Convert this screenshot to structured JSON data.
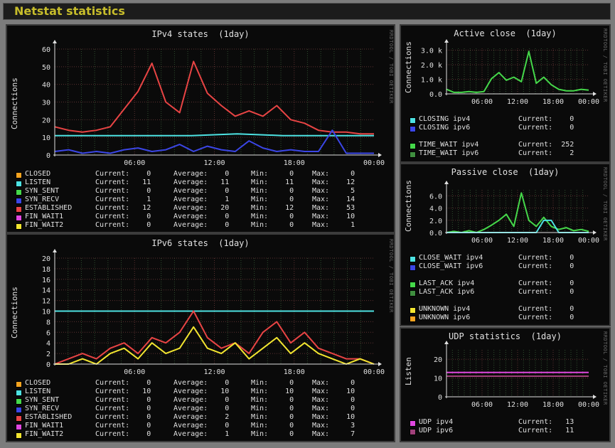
{
  "header": {
    "title": "Netstat statistics"
  },
  "rrdtool_label": "RRDTOOL / TOBI OETIKER",
  "stat_labels": {
    "current": "Current:",
    "average": "Average:",
    "min": "Min:",
    "max": "Max:"
  },
  "panels": {
    "ipv4": {
      "title": "IPv4 states  (1day)",
      "ylabel": "Connections",
      "yticks": [
        "0",
        "10",
        "20",
        "30",
        "40",
        "50",
        "60"
      ],
      "xticks": [
        "06:00",
        "12:00",
        "18:00",
        "00:00"
      ],
      "legend": [
        {
          "name": "CLOSED",
          "color": "#f4a31f",
          "cur": "0",
          "avg": "0",
          "min": "0",
          "max": "0"
        },
        {
          "name": "LISTEN",
          "color": "#4de2e2",
          "cur": "11",
          "avg": "11",
          "min": "11",
          "max": "12"
        },
        {
          "name": "SYN_SENT",
          "color": "#45d84a",
          "cur": "0",
          "avg": "0",
          "min": "0",
          "max": "5"
        },
        {
          "name": "SYN_RECV",
          "color": "#3b46e6",
          "cur": "1",
          "avg": "1",
          "min": "0",
          "max": "14"
        },
        {
          "name": "ESTABLISHED",
          "color": "#e84444",
          "cur": "12",
          "avg": "20",
          "min": "12",
          "max": "53"
        },
        {
          "name": "FIN_WAIT1",
          "color": "#e047e0",
          "cur": "0",
          "avg": "0",
          "min": "0",
          "max": "10"
        },
        {
          "name": "FIN_WAIT2",
          "color": "#f2e530",
          "cur": "0",
          "avg": "0",
          "min": "0",
          "max": "1"
        }
      ]
    },
    "ipv6": {
      "title": "IPv6 states  (1day)",
      "ylabel": "Connections",
      "yticks": [
        "0",
        "2",
        "4",
        "6",
        "8",
        "10",
        "12",
        "14",
        "16",
        "18",
        "20"
      ],
      "xticks": [
        "06:00",
        "12:00",
        "18:00",
        "00:00"
      ],
      "legend": [
        {
          "name": "CLOSED",
          "color": "#f4a31f",
          "cur": "0",
          "avg": "0",
          "min": "0",
          "max": "0"
        },
        {
          "name": "LISTEN",
          "color": "#4de2e2",
          "cur": "10",
          "avg": "10",
          "min": "10",
          "max": "10"
        },
        {
          "name": "SYN_SENT",
          "color": "#45d84a",
          "cur": "0",
          "avg": "0",
          "min": "0",
          "max": "0"
        },
        {
          "name": "SYN_RECV",
          "color": "#3b46e6",
          "cur": "0",
          "avg": "0",
          "min": "0",
          "max": "0"
        },
        {
          "name": "ESTABLISHED",
          "color": "#e84444",
          "cur": "0",
          "avg": "2",
          "min": "0",
          "max": "10"
        },
        {
          "name": "FIN_WAIT1",
          "color": "#e047e0",
          "cur": "0",
          "avg": "0",
          "min": "0",
          "max": "3"
        },
        {
          "name": "FIN_WAIT2",
          "color": "#f2e530",
          "cur": "0",
          "avg": "1",
          "min": "0",
          "max": "7"
        }
      ]
    },
    "active": {
      "title": "Active close  (1day)",
      "ylabel": "Connections",
      "yticks": [
        "0.0",
        "1.0 k",
        "2.0 k",
        "3.0 k"
      ],
      "xticks": [
        "06:00",
        "12:00",
        "18:00",
        "00:00"
      ],
      "legend": [
        {
          "name": "CLOSING ipv4",
          "color": "#4de2e2",
          "cur": "0"
        },
        {
          "name": "CLOSING ipv6",
          "color": "#3b46e6",
          "cur": "0"
        },
        {
          "name": "TIME_WAIT ipv4",
          "color": "#45d84a",
          "cur": "252"
        },
        {
          "name": "TIME_WAIT ipv6",
          "color": "#3f8e3f",
          "cur": "2"
        }
      ]
    },
    "passive": {
      "title": "Passive close  (1day)",
      "ylabel": "Connections",
      "yticks": [
        "0.0",
        "2.0",
        "4.0",
        "6.0"
      ],
      "xticks": [
        "06:00",
        "12:00",
        "18:00",
        "00:00"
      ],
      "legend": [
        {
          "name": "CLOSE_WAIT ipv4",
          "color": "#4de2e2",
          "cur": "0"
        },
        {
          "name": "CLOSE_WAIT ipv6",
          "color": "#3b46e6",
          "cur": "0"
        },
        {
          "name": "LAST_ACK ipv4",
          "color": "#45d84a",
          "cur": "0"
        },
        {
          "name": "LAST_ACK ipv6",
          "color": "#3f8e3f",
          "cur": "0"
        },
        {
          "name": "UNKNOWN ipv4",
          "color": "#f2e530",
          "cur": "0"
        },
        {
          "name": "UNKNOWN ipv6",
          "color": "#f4a31f",
          "cur": "0"
        }
      ]
    },
    "udp": {
      "title": "UDP statistics  (1day)",
      "ylabel": "Listen",
      "yticks": [
        "0",
        "10",
        "20"
      ],
      "xticks": [
        "06:00",
        "12:00",
        "18:00",
        "00:00"
      ],
      "legend": [
        {
          "name": "UDP ipv4",
          "color": "#e047e0",
          "cur": "13"
        },
        {
          "name": "UDP ipv6",
          "color": "#a0407a",
          "cur": "11"
        }
      ]
    }
  },
  "chart_data": [
    {
      "type": "line",
      "title": "IPv4 states  (1day)",
      "ylabel": "Connections",
      "ylim": [
        0,
        60
      ],
      "x": [
        "06:00",
        "12:00",
        "18:00",
        "00:00"
      ],
      "series": [
        {
          "name": "LISTEN",
          "values": [
            11,
            11,
            11,
            11,
            12,
            11,
            11,
            11
          ]
        },
        {
          "name": "ESTABLISHED",
          "values": [
            16,
            14,
            13,
            14,
            16,
            26,
            36,
            52,
            30,
            24,
            53,
            35,
            28,
            22,
            25,
            22,
            28,
            20,
            18,
            14,
            13,
            13,
            12,
            12
          ]
        },
        {
          "name": "SYN_RECV",
          "values": [
            2,
            3,
            1,
            2,
            1,
            3,
            4,
            2,
            3,
            6,
            2,
            5,
            3,
            2,
            8,
            4,
            2,
            3,
            2,
            2,
            14,
            1,
            1,
            1
          ]
        }
      ]
    },
    {
      "type": "line",
      "title": "IPv6 states  (1day)",
      "ylabel": "Connections",
      "ylim": [
        0,
        20
      ],
      "x": [
        "06:00",
        "12:00",
        "18:00",
        "00:00"
      ],
      "series": [
        {
          "name": "LISTEN",
          "values": [
            10,
            10,
            10,
            10,
            10,
            10,
            10,
            10
          ]
        },
        {
          "name": "ESTABLISHED",
          "values": [
            0,
            1,
            2,
            1,
            3,
            4,
            2,
            5,
            4,
            6,
            10,
            5,
            3,
            4,
            2,
            6,
            8,
            4,
            6,
            3,
            2,
            1,
            1,
            0
          ]
        },
        {
          "name": "FIN_WAIT2",
          "values": [
            0,
            0,
            1,
            0,
            2,
            3,
            1,
            4,
            2,
            3,
            7,
            3,
            2,
            4,
            1,
            3,
            5,
            2,
            4,
            2,
            1,
            0,
            1,
            0
          ]
        }
      ]
    },
    {
      "type": "line",
      "title": "Active close  (1day)",
      "ylabel": "Connections",
      "ylim": [
        0,
        3000
      ],
      "x": [
        "06:00",
        "12:00",
        "18:00",
        "00:00"
      ],
      "series": [
        {
          "name": "TIME_WAIT ipv4",
          "values": [
            300,
            100,
            100,
            150,
            100,
            150,
            1000,
            1400,
            900,
            1100,
            800,
            2800,
            700,
            1100,
            600,
            300,
            200,
            200,
            300,
            250
          ]
        }
      ]
    },
    {
      "type": "line",
      "title": "Passive close  (1day)",
      "ylabel": "Connections",
      "ylim": [
        0,
        7
      ],
      "x": [
        "06:00",
        "12:00",
        "18:00",
        "00:00"
      ],
      "series": [
        {
          "name": "LAST_ACK ipv4",
          "values": [
            0,
            0.2,
            0,
            0.3,
            0,
            0.5,
            1.2,
            2,
            3,
            1,
            6.5,
            2,
            1,
            2.5,
            1,
            0.5,
            0.8,
            0.3,
            0.5,
            0.2
          ]
        },
        {
          "name": "CLOSE_WAIT ipv4",
          "values": [
            0,
            0,
            0,
            0,
            0,
            0,
            0,
            0,
            0,
            0,
            0,
            0,
            0,
            2,
            2,
            0,
            0,
            0,
            0,
            0
          ]
        }
      ]
    },
    {
      "type": "line",
      "title": "UDP statistics  (1day)",
      "ylabel": "Listen",
      "ylim": [
        0,
        25
      ],
      "x": [
        "06:00",
        "12:00",
        "18:00",
        "00:00"
      ],
      "series": [
        {
          "name": "UDP ipv4",
          "values": [
            13,
            13,
            13,
            13
          ]
        },
        {
          "name": "UDP ipv6",
          "values": [
            11,
            11,
            11,
            11
          ]
        }
      ]
    }
  ]
}
